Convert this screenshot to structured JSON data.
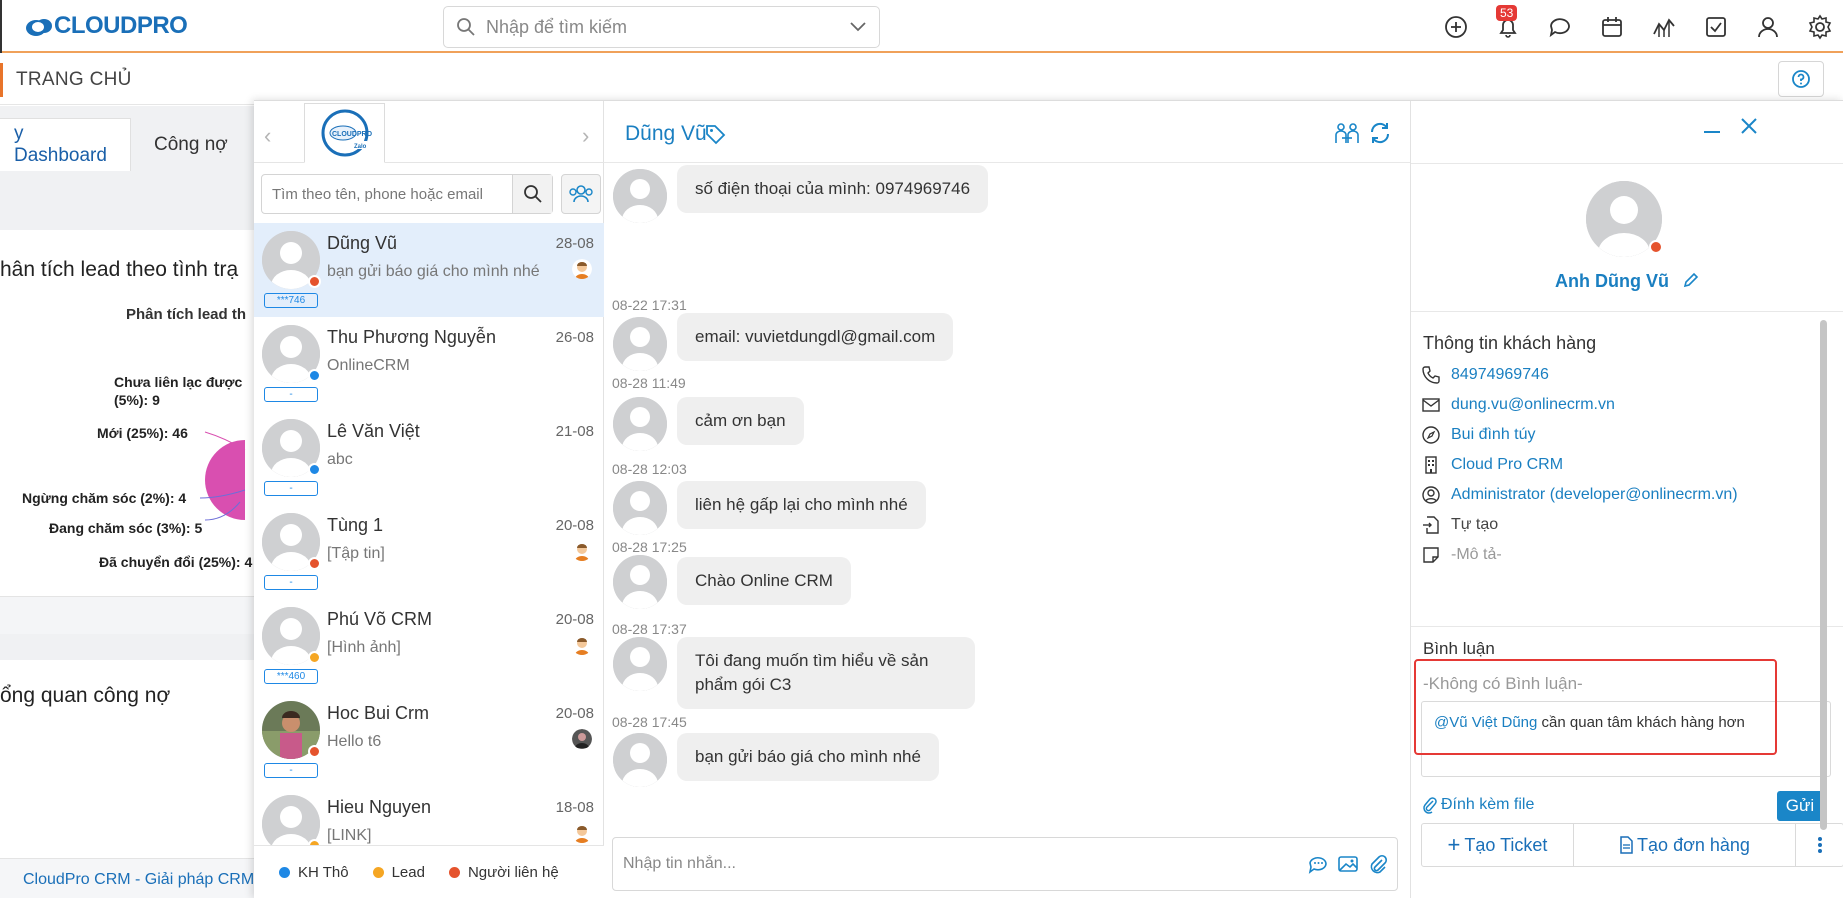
{
  "app": {
    "logo_text": "CLOUDPRO",
    "search_placeholder": "Nhập để tìm kiếm",
    "notification_count": "53",
    "icons": [
      "add-icon",
      "bell-icon",
      "chat-icon",
      "calendar-icon",
      "report-icon",
      "task-icon",
      "user-icon",
      "gear-icon"
    ]
  },
  "breadcrumb": {
    "title": "TRANG CHỦ"
  },
  "dashboard": {
    "tabs": [
      "y Dashboard",
      "Công nợ"
    ],
    "card1_title": "hân tích lead theo tình trạ",
    "chart_subtitle": "Phân tích lead th",
    "pie_labels": [
      "Chưa liên lạc được",
      "(5%): 9",
      "Mới (25%): 46",
      "Ngừng chăm sóc (2%): 4",
      "Đang chăm sóc (3%): 5",
      "Đã chuyển đổi (25%): 4"
    ],
    "card2_title": "ổng quan công nợ",
    "footer": "CloudPro CRM - Giải pháp CRM"
  },
  "conversations": {
    "search_placeholder": "Tìm theo tên, phone hoặc email",
    "items": [
      {
        "name": "Dũng Vũ",
        "date": "28-08",
        "message": "bạn gửi báo giá cho mình nhé",
        "tag": "***746",
        "status_color": "#e5532d",
        "active": true,
        "has_mini": true
      },
      {
        "name": "Thu Phương Nguyễn",
        "date": "26-08",
        "message": "OnlineCRM",
        "tag": "-",
        "status_color": "#1e88e5",
        "active": false,
        "has_mini": false
      },
      {
        "name": "Lê Văn Việt",
        "date": "21-08",
        "message": "abc",
        "tag": "-",
        "status_color": "#1e88e5",
        "active": false,
        "has_mini": false
      },
      {
        "name": "Tùng 1",
        "date": "20-08",
        "message": "[Tập tin]",
        "tag": "-",
        "status_color": "#e5532d",
        "active": false,
        "has_mini": true
      },
      {
        "name": "Phú Võ CRM",
        "date": "20-08",
        "message": "[Hình ảnh]",
        "tag": "***460",
        "status_color": "#f5a623",
        "active": false,
        "has_mini": true
      },
      {
        "name": "Hoc Bui Crm",
        "date": "20-08",
        "message": "Hello t6",
        "tag": "-",
        "status_color": "#e5532d",
        "active": false,
        "has_mini": true
      },
      {
        "name": "Hieu Nguyen",
        "date": "18-08",
        "message": "[LINK]",
        "tag": "-",
        "status_color": "#f5a623",
        "active": false,
        "has_mini": true
      }
    ],
    "legend": [
      {
        "label": "KH Thô",
        "color": "#1e88e5"
      },
      {
        "label": "Lead",
        "color": "#f5a623"
      },
      {
        "label": "Người liên hệ",
        "color": "#e5532d"
      }
    ]
  },
  "chat": {
    "contact_name": "Dũng Vũ",
    "messages": [
      {
        "time": "",
        "text": "số điện thoại của mình: 0974969746"
      },
      {
        "time": "08-22 17:31",
        "text": "email: vuvietdungdl@gmail.com"
      },
      {
        "time": "08-28 11:49",
        "text": "cảm ơn bạn"
      },
      {
        "time": "08-28 12:03",
        "text": "liên hệ gấp lại cho mình nhé"
      },
      {
        "time": "08-28 17:25",
        "text": "Chào Online CRM"
      },
      {
        "time": "08-28 17:37",
        "text": "Tôi đang muốn tìm hiểu về sản phẩm gói C3"
      },
      {
        "time": "08-28 17:45",
        "text": "bạn gửi báo giá cho mình nhé"
      }
    ],
    "composer_placeholder": "Nhập tin nhắn..."
  },
  "customer": {
    "name": "Anh Dũng Vũ",
    "section_title": "Thông tin khách hàng",
    "phone": "84974969746",
    "email": "dung.vu@onlinecrm.vn",
    "address": "Bui đình túy",
    "company": "Cloud Pro CRM",
    "assignee": "Administrator (developer@onlinecrm.vn)",
    "source": "Tự tạo",
    "description": "-Mô tả-",
    "comments_title": "Bình luận",
    "no_comments": "-Không có Bình luận-",
    "comment_mention": "@Vũ Việt Dũng",
    "comment_text": " cần quan tâm khách hàng hơn",
    "attach_label": "Đính kèm file",
    "send_label": "Gửi",
    "create_ticket": "Tạo Ticket",
    "create_order": "Tạo đơn hàng"
  }
}
